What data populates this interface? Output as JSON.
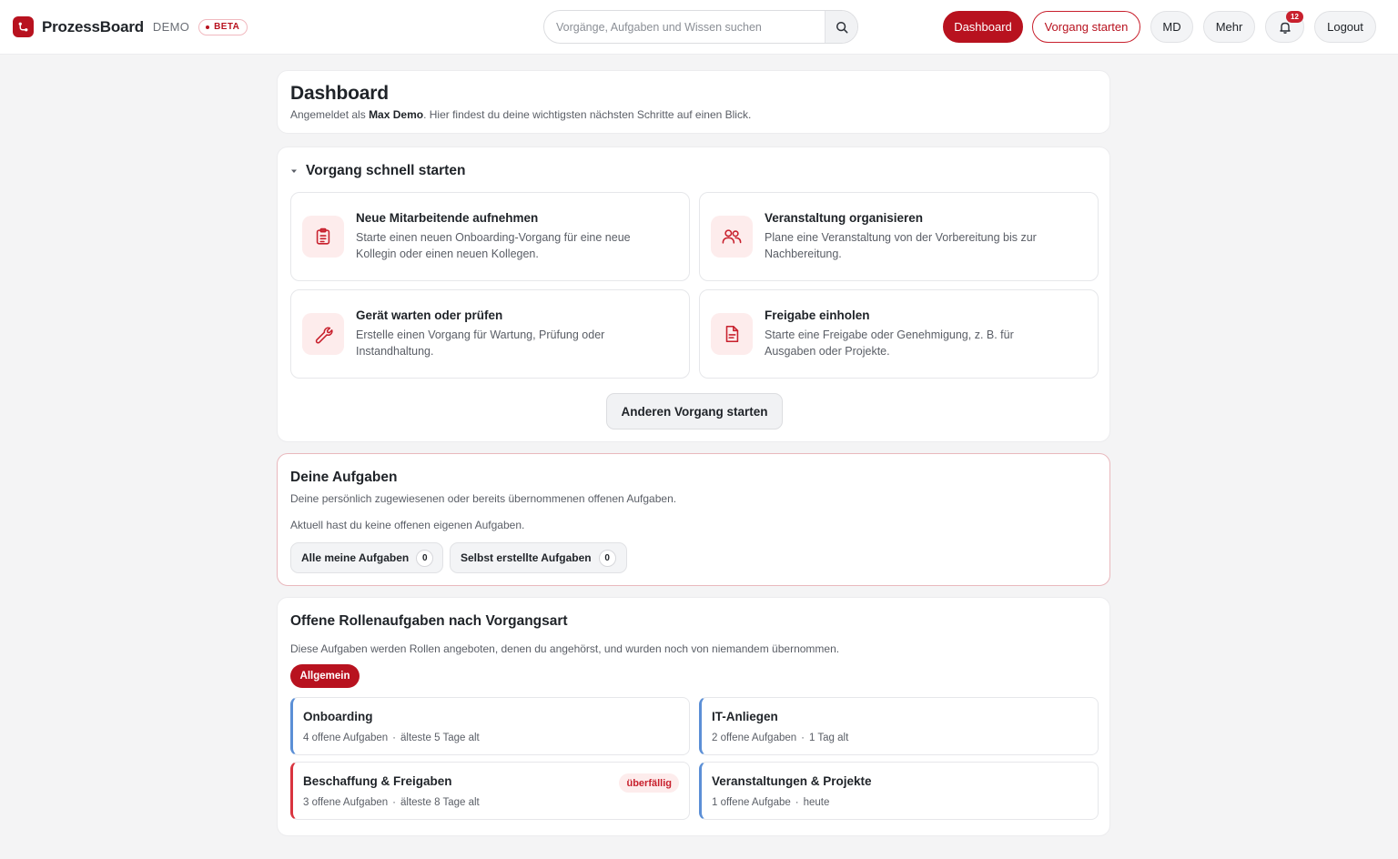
{
  "header": {
    "brand_name": "ProzessBoard",
    "environment": "DEMO",
    "beta_label": "BETA",
    "search_placeholder": "Vorgänge, Aufgaben und Wissen suchen",
    "nav": {
      "dashboard": "Dashboard",
      "start_process": "Vorgang starten",
      "user_initials": "MD",
      "more": "Mehr",
      "notifications_count": "12",
      "logout": "Logout"
    }
  },
  "intro": {
    "title": "Dashboard",
    "subtitle_prefix": "Angemeldet als ",
    "user_name": "Max Demo",
    "subtitle_suffix": ". Hier findest du deine wichtigsten nächsten Schritte auf einen Blick."
  },
  "quick_start": {
    "title": "Vorgang schnell starten",
    "tiles": [
      {
        "icon": "clipboard-icon",
        "title": "Neue Mitarbeitende aufnehmen",
        "description": "Starte einen neuen Onboarding-Vorgang für eine neue Kollegin oder einen neuen Kollegen."
      },
      {
        "icon": "users-icon",
        "title": "Veranstaltung organisieren",
        "description": "Plane eine Veranstaltung von der Vorbereitung bis zur Nachbereitung."
      },
      {
        "icon": "wrench-icon",
        "title": "Gerät warten oder prüfen",
        "description": "Erstelle einen Vorgang für Wartung, Prüfung oder Instandhaltung."
      },
      {
        "icon": "document-icon",
        "title": "Freigabe einholen",
        "description": "Starte eine Freigabe oder Genehmigung, z. B. für Ausgaben oder Projekte."
      }
    ],
    "other_button": "Anderen Vorgang starten"
  },
  "my_tasks": {
    "title": "Deine Aufgaben",
    "subtitle": "Deine persönlich zugewiesenen oder bereits übernommenen offenen Aufgaben.",
    "empty_text": "Aktuell hast du keine offenen eigenen Aufgaben.",
    "filters": [
      {
        "label": "Alle meine Aufgaben",
        "count": "0"
      },
      {
        "label": "Selbst erstellte Aufgaben",
        "count": "0"
      }
    ]
  },
  "role_tasks": {
    "title": "Offene Rollenaufgaben nach Vorgangsart",
    "subtitle": "Diese Aufgaben werden Rollen angeboten, denen du angehörst, und wurden noch von niemandem übernommen.",
    "active_filter": "Allgemein",
    "tiles": [
      {
        "title": "Onboarding",
        "count_text": "4 offene Aufgaben",
        "age_text": "älteste 5 Tage alt",
        "badge": ""
      },
      {
        "title": "IT-Anliegen",
        "count_text": "2 offene Aufgaben",
        "age_text": "1 Tag alt",
        "badge": ""
      },
      {
        "title": "Beschaffung & Freigaben",
        "count_text": "3 offene Aufgaben",
        "age_text": "älteste 8 Tage alt",
        "badge": "überfällig"
      },
      {
        "title": "Veranstaltungen & Projekte",
        "count_text": "1 offene Aufgabe",
        "age_text": "heute",
        "badge": ""
      }
    ],
    "separator": "·"
  },
  "colors": {
    "brand": "#b8121f",
    "accent_tint": "#fdecec",
    "role_border_default": "#5b8fd6",
    "role_border_overdue": "#d9343f"
  }
}
